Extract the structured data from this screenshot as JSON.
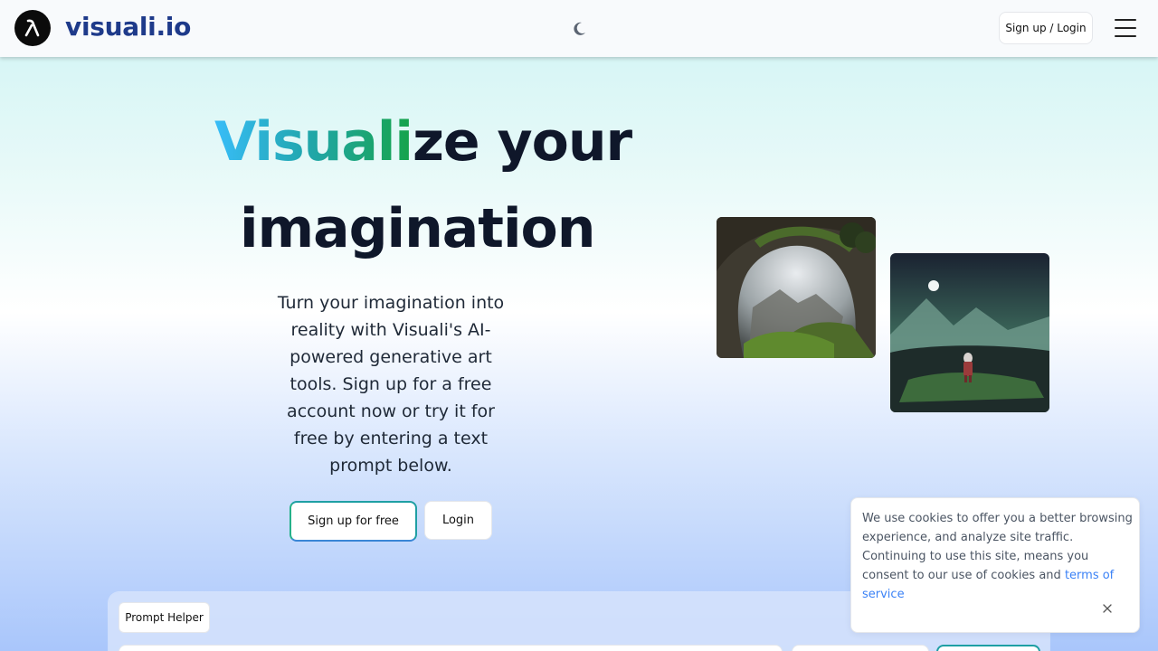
{
  "header": {
    "brand": "visuali.io",
    "logo_icon": "lambda-logo-icon",
    "theme_icon": "moon-icon",
    "signup_login_label": "Sign up / Login",
    "menu_icon": "hamburger-menu-icon"
  },
  "hero": {
    "title_gradient": "Visuali",
    "title_rest": "ze your",
    "title_line2": "imagination",
    "description": "Turn your imagination into reality with Visuali's AI-powered generative art tools. Sign up for a free account now or try it for free by entering a text prompt below.",
    "signup_free_label": "Sign up for free",
    "login_label": "Login"
  },
  "prompt": {
    "helper_label": "Prompt Helper"
  },
  "cookie": {
    "text": "We use cookies to offer you a better browsing experience, and analyze site traffic. Continuing to use this site, means you consent to our use of cookies and ",
    "link_text": "terms of service",
    "close_icon": "close-icon"
  },
  "colors": {
    "brand": "#1e3a8a",
    "accent_teal": "#1f9fa4",
    "gradient_start": "#38bdf8",
    "gradient_end": "#16a34a",
    "link": "#3b82f6"
  }
}
